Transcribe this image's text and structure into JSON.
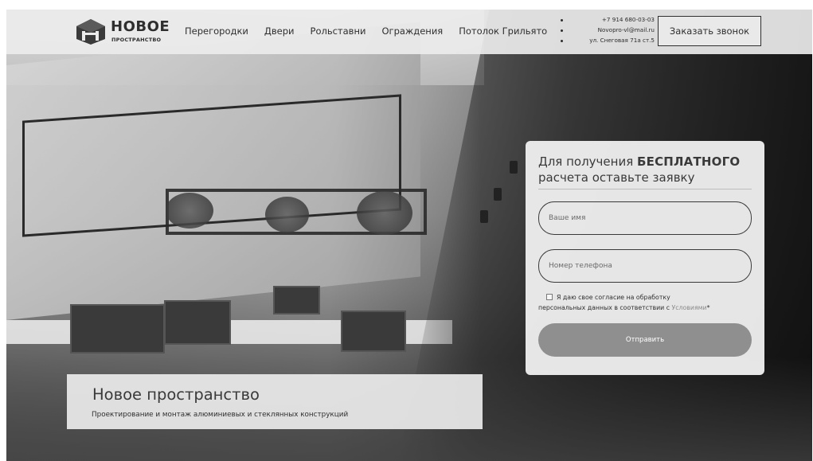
{
  "header": {
    "logo": {
      "title": "НОВОЕ",
      "subtitle": "ПРОСТРАНСТВО",
      "icon": "hexagon-logo-icon"
    },
    "nav": [
      {
        "label": "Перегородки"
      },
      {
        "label": "Двери"
      },
      {
        "label": "Рольставни"
      },
      {
        "label": "Ограждения"
      },
      {
        "label": "Потолок Грильято"
      }
    ],
    "contacts": [
      {
        "text": "+7 914 680-03-03"
      },
      {
        "text": "Novopro-vl@mail.ru"
      },
      {
        "text": "ул. Снеговая 71а ст.5"
      }
    ],
    "call_button": "Заказать звонок"
  },
  "form": {
    "title_prefix": "Для получения ",
    "title_bold": "БЕСПЛАТНОГО",
    "title_suffix": "расчета оставьте заявку",
    "name_placeholder": "Ваше имя",
    "phone_placeholder": "Номер телефона",
    "consent_line1": "Я даю свое согласие на обработку",
    "consent_line2_prefix": "персональных данных в соответствии с ",
    "consent_link": "Условиями",
    "consent_suffix": "*",
    "submit_label": "Отправить"
  },
  "banner": {
    "title": "Новое пространство",
    "subtitle": "Проектирование и монтаж алюминиевых и стеклянных конструкций"
  },
  "colors": {
    "header_bg": "#ebebeb",
    "text_dark": "#2f2f2f",
    "button_gray": "#8f8f8f",
    "card_bg": "#eeeeee"
  }
}
